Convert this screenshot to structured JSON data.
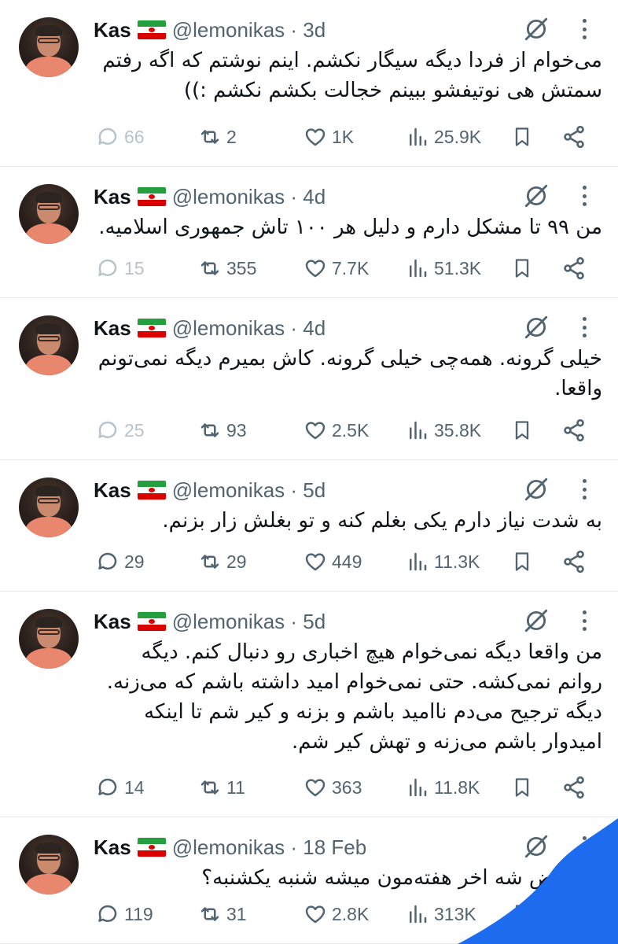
{
  "user": {
    "name": "Kas",
    "handle": "@lemonikas"
  },
  "tweets": [
    {
      "time": "3d",
      "text_lines": [
        "می‌خوام از فردا دیگه سیگار نکشم. اینم نوشتم که اگه رفتم",
        "سمتش هی نوتیفشو ببینم خجالت بکشم نکشم :))"
      ],
      "replies": "66",
      "reposts": "2",
      "likes": "1K",
      "views": "25.9K",
      "replies_dim": true
    },
    {
      "time": "4d",
      "text_lines": [
        "من ۹۹ تا مشکل دارم و دلیل هر ۱۰۰ تاش جمهوری اسلامیه."
      ],
      "replies": "15",
      "reposts": "355",
      "likes": "7.7K",
      "views": "51.3K",
      "replies_dim": true
    },
    {
      "time": "4d",
      "text_lines": [
        "خیلی گرونه. همه‌چی خیلی گرونه. کاش بمیرم دیگه نمی‌تونم",
        "واقعا."
      ],
      "replies": "25",
      "reposts": "93",
      "likes": "2.5K",
      "views": "35.8K",
      "replies_dim": true
    },
    {
      "time": "5d",
      "text_lines": [
        "به شدت نیاز دارم یکی بغلم کنه و تو بغلش زار بزنم."
      ],
      "replies": "29",
      "reposts": "29",
      "likes": "449",
      "views": "11.3K",
      "replies_dim": false
    },
    {
      "time": "5d",
      "text_lines": [
        "من واقعا دیگه نمی‌خوام هیچ اخباری رو دنبال کنم. دیگه",
        "روانم نمی‌کشه. حتی نمی‌خوام امید داشته باشم که می‌زنه.",
        "دیگه ترجیح می‌دم ناامید باشم و بزنه و کیر شم تا اینکه",
        "امیدوار باشم می‌زنه و تهش کیر شم."
      ],
      "replies": "14",
      "reposts": "11",
      "likes": "363",
      "views": "11.8K",
      "replies_dim": false
    },
    {
      "time": "18 Feb",
      "text_lines": [
        "ت عوض شه اخر هفته‌مون میشه شنبه یکشنبه؟"
      ],
      "replies": "119",
      "reposts": "31",
      "likes": "2.8K",
      "views": "313K",
      "replies_dim": false
    }
  ],
  "colors": {
    "text": "#0f1419",
    "muted": "#536471",
    "dim": "#b9c3cc",
    "divider": "#e6e9ec",
    "overlay_blue": "#1d6cf0"
  }
}
